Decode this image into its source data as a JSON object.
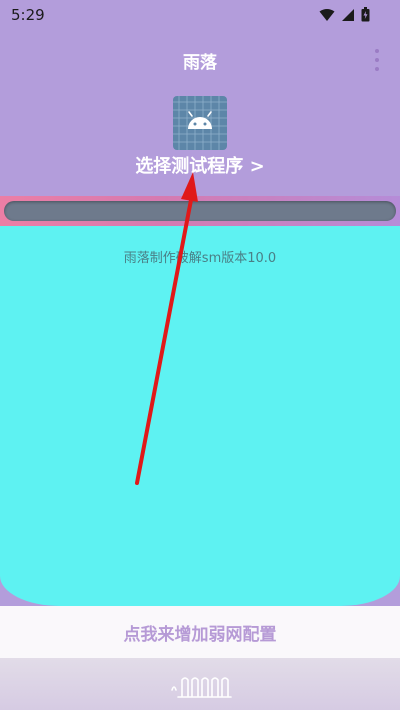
{
  "status_bar": {
    "time": "5:29",
    "icons": [
      "wifi-icon",
      "signal-icon",
      "battery-icon"
    ]
  },
  "header": {
    "title": "雨落",
    "menu_icon": "more-vert-icon"
  },
  "app_picker": {
    "icon": "android-icon",
    "label": "选择测试程序 >"
  },
  "progress": {
    "value": 0
  },
  "main": {
    "version_text": "雨落制作破解sm版本10.0"
  },
  "weak_net": {
    "button_label": "点我来增加弱网配置"
  },
  "footer": {
    "icon": "signal-wave-icon"
  },
  "colors": {
    "top_bg": "#b39ddb",
    "main_bg": "#5ef2f2",
    "button_text": "#b69ad6",
    "annotation_arrow": "#e01919"
  }
}
